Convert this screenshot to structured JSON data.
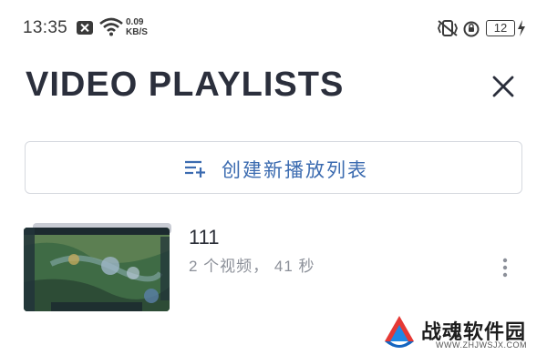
{
  "status_bar": {
    "time": "13:35",
    "net_speed_value": "0.09",
    "net_speed_unit": "KB/S",
    "battery_level": "12",
    "icons": [
      "close-notification-icon",
      "wifi-icon",
      "vibrate-icon",
      "alarm-icon",
      "battery-icon",
      "charging-icon"
    ]
  },
  "header": {
    "title": "VIDEO PLAYLISTS",
    "close_icon": "close-icon"
  },
  "create_playlist": {
    "label": "创建新播放列表",
    "icon": "playlist-add-icon",
    "accent_color": "#3b6bb0"
  },
  "playlists": [
    {
      "title": "111",
      "meta": "2 个视频， 41 秒",
      "thumbnail": "game-scene-thumbnail",
      "more_icon": "more-vertical-icon"
    }
  ],
  "watermark": {
    "name": "战魂软件园",
    "url": "WWW.ZHJWSJX.COM"
  }
}
